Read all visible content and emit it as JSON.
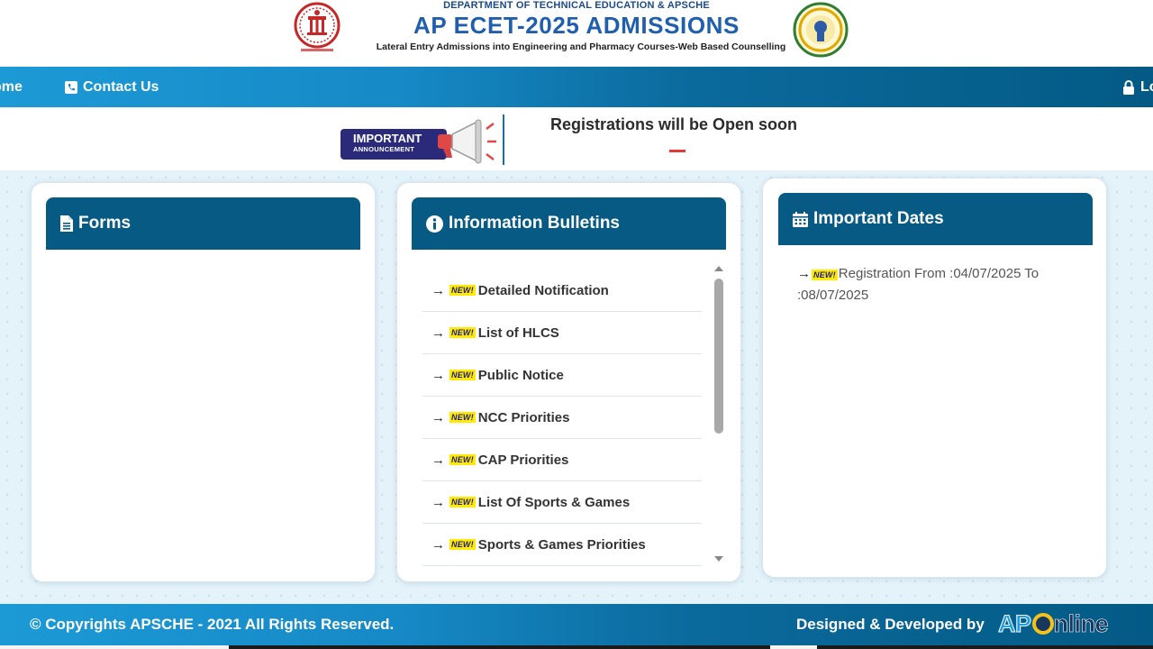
{
  "header": {
    "department": "DEPARTMENT OF TECHNICAL EDUCATION & APSCHE",
    "title": "AP ECET-2025 ADMISSIONS",
    "subtitle": "Lateral Entry Admissions into Engineering and Pharmacy Courses-Web Based Counselling",
    "left_logo_icon": "apsche-emblem-icon",
    "right_logo_icon": "ap-state-emblem-icon"
  },
  "nav": {
    "home_label": "ome",
    "contact_label": "Contact Us",
    "login_label": "Lo",
    "contact_icon": "phone-icon",
    "login_icon": "lock-icon"
  },
  "announcement": {
    "badge_title": "IMPORTANT",
    "badge_sub": "ANNOUNCEMENT",
    "badge_icon": "megaphone-icon",
    "text": "Registrations will be Open soon"
  },
  "forms": {
    "title": "Forms",
    "icon": "file-icon"
  },
  "bulletins": {
    "title": "Information Bulletins",
    "icon": "info-circle-icon",
    "new_label": "NEW!",
    "items": [
      {
        "label": "Detailed Notification"
      },
      {
        "label": "List of HLCS"
      },
      {
        "label": "Public Notice"
      },
      {
        "label": "NCC Priorities"
      },
      {
        "label": "CAP Priorities"
      },
      {
        "label": "List Of Sports & Games"
      },
      {
        "label": "Sports & Games Priorities"
      }
    ]
  },
  "dates": {
    "title": "Important Dates",
    "icon": "calendar-icon",
    "new_label": "NEW!",
    "item_text": "Registration From :04/07/2025 To :08/07/2025"
  },
  "footer": {
    "copyright": "© Copyrights APSCHE - 2021 All Rights Reserved.",
    "developed_by": "Designed & Developed by",
    "logo_ap": "AP",
    "logo_online": "nline"
  },
  "colors": {
    "nav_gradient_start": "#1c9ad6",
    "nav_gradient_end": "#035a85",
    "card_header": "#075a84",
    "new_badge_bg": "#ffea00",
    "accent_red": "#e53935"
  }
}
